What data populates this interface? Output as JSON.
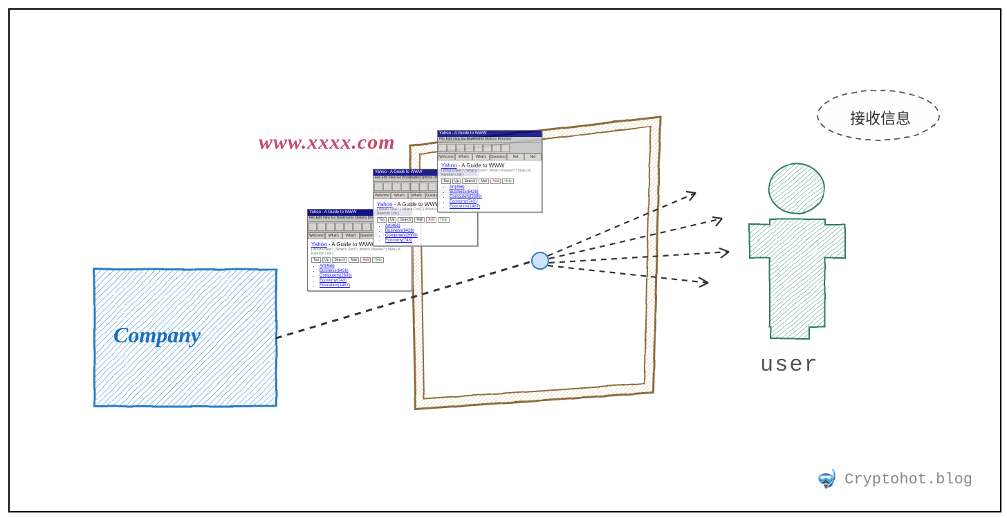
{
  "company": {
    "label": "Company",
    "color": "#3b8fd3"
  },
  "url": "www.xxxx.com",
  "user": {
    "label": "user",
    "color": "#3a8f6f"
  },
  "bubble": {
    "text": "接收信息"
  },
  "watermark": {
    "text": "Cryptohot.blog",
    "icon": "🤿"
  },
  "browser_windows": [
    {
      "title": "Yahoo - A Guide to WWW",
      "menu": "File  Edit  View  Go  Bookmarks  Options  Directory",
      "tabs": [
        "Welcome",
        "What's New!",
        "What's Cool!",
        "Questions",
        "Net Search",
        "Net Directory"
      ],
      "heading_link": "Yahoo",
      "heading_rest": " - A Guide to WWW",
      "sub": "[ What's New? | What's Cool? | What's Popular? | Stats | A Random Link ]",
      "btns": [
        "Top",
        "Up",
        "Search",
        "Mail",
        "Add",
        "Help"
      ],
      "links": [
        "Art(466)",
        "Business(6426)",
        "Computers(2609)",
        "Economy(743)",
        "Education(1487)"
      ]
    }
  ]
}
